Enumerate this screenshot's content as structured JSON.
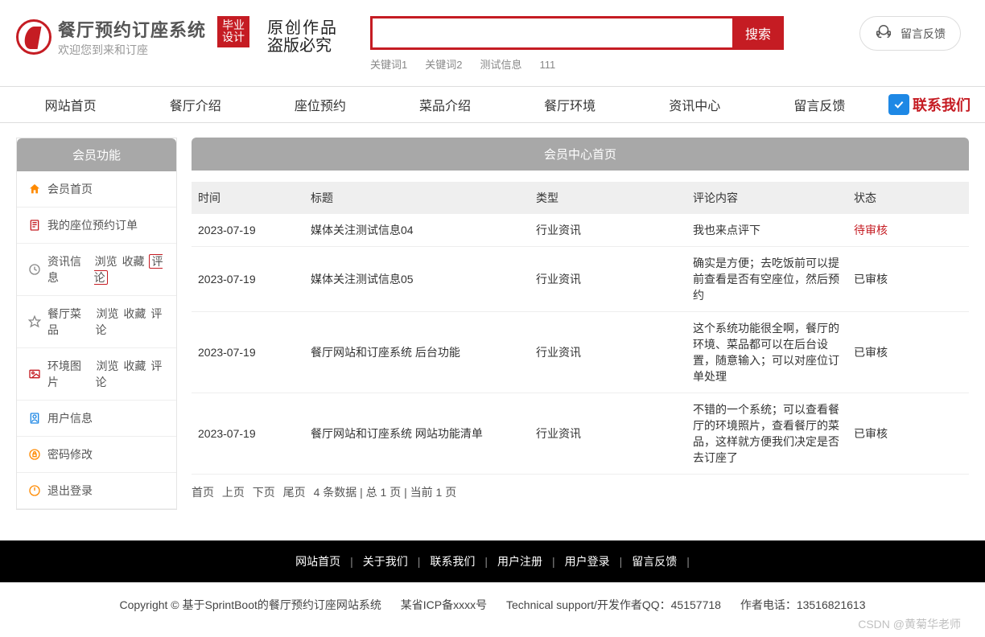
{
  "header": {
    "app_title": "餐厅预约订座系统",
    "app_sub": "欢迎您到来和订座",
    "badge": "毕业\n设计",
    "calligraphy_l1": "原创作品",
    "calligraphy_l2": "盗版必究",
    "search_btn": "搜索",
    "keywords": [
      "关键词1",
      "关键词2",
      "测试信息",
      "111"
    ],
    "feedback": "留言反馈"
  },
  "nav": {
    "items": [
      "网站首页",
      "餐厅介绍",
      "座位预约",
      "菜品介绍",
      "餐厅环境",
      "资讯中心",
      "留言反馈"
    ],
    "contact": "联系我们"
  },
  "sidebar": {
    "title": "会员功能",
    "items": [
      {
        "icon": "home",
        "label": "会员首页"
      },
      {
        "icon": "order",
        "label": "我的座位预约订单"
      },
      {
        "icon": "clock",
        "label": "资讯信息",
        "subs": [
          "浏览",
          "收藏",
          "评论"
        ],
        "highlight_sub": 2
      },
      {
        "icon": "star",
        "label": "餐厅菜品",
        "subs": [
          "浏览",
          "收藏",
          "评论"
        ]
      },
      {
        "icon": "image",
        "label": "环境图片",
        "subs": [
          "浏览",
          "收藏",
          "评论"
        ]
      },
      {
        "icon": "user",
        "label": "用户信息"
      },
      {
        "icon": "lock",
        "label": "密码修改"
      },
      {
        "icon": "logout",
        "label": "退出登录"
      }
    ]
  },
  "main": {
    "panel_title": "会员中心首页",
    "columns": [
      "时间",
      "标题",
      "类型",
      "评论内容",
      "状态"
    ],
    "rows": [
      {
        "time": "2023-07-19",
        "title": "媒体关注测试信息04",
        "type": "行业资讯",
        "comment": "我也来点评下",
        "status": "待审核",
        "pending": true
      },
      {
        "time": "2023-07-19",
        "title": "媒体关注测试信息05",
        "type": "行业资讯",
        "comment": "确实是方便；去吃饭前可以提前查看是否有空座位，然后预约",
        "status": "已审核",
        "pending": false
      },
      {
        "time": "2023-07-19",
        "title": "餐厅网站和订座系统 后台功能",
        "type": "行业资讯",
        "comment": "这个系统功能很全啊，餐厅的环境、菜品都可以在后台设置，随意输入；可以对座位订单处理",
        "status": "已审核",
        "pending": false
      },
      {
        "time": "2023-07-19",
        "title": "餐厅网站和订座系统 网站功能清单",
        "type": "行业资讯",
        "comment": "不错的一个系统；可以查看餐厅的环境照片，查看餐厅的菜品，这样就方便我们决定是否去订座了",
        "status": "已审核",
        "pending": false
      }
    ],
    "pager": {
      "first": "首页",
      "prev": "上页",
      "next": "下页",
      "last": "尾页",
      "summary": "4 条数据 | 总 1 页 | 当前 1 页"
    }
  },
  "footer_dark": [
    "网站首页",
    "关于我们",
    "联系我们",
    "用户注册",
    "用户登录",
    "留言反馈"
  ],
  "footer_light": {
    "copyright": "Copyright © 基于SprintBoot的餐厅预约订座网站系统",
    "icp": "某省ICP备xxxx号",
    "tech": "Technical support/开发作者QQ：45157718",
    "phone": "作者电话：13516821613"
  },
  "watermark": "CSDN @黄菊华老师"
}
